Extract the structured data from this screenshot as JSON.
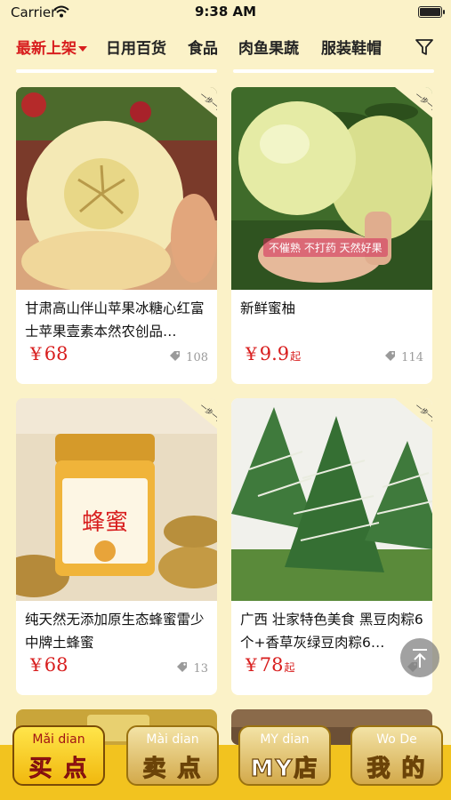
{
  "status_bar": {
    "carrier": "Carrier",
    "time": "9:38 AM"
  },
  "tabs": [
    {
      "label": "最新上架",
      "active": true
    },
    {
      "label": "日用百货",
      "active": false
    },
    {
      "label": "食品",
      "active": false
    },
    {
      "label": "肉鱼果蔬",
      "active": false
    },
    {
      "label": "服装鞋帽",
      "active": false
    }
  ],
  "badge": "一步一品",
  "products": [
    {
      "title": "甘肃高山伴山苹果冰糖心红富士苹果壹素本然农创品…",
      "price_symbol": "¥",
      "price": "68",
      "qi": "",
      "sold": "108",
      "caption": ""
    },
    {
      "title": "新鲜蜜柚",
      "price_symbol": "¥",
      "price": "9.9",
      "qi": "起",
      "sold": "114",
      "caption": "不催熟 不打药 天然好果"
    },
    {
      "title": "纯天然无添加原生态蜂蜜雷少中牌土蜂蜜",
      "price_symbol": "¥",
      "price": "68",
      "qi": "",
      "sold": "13",
      "caption": ""
    },
    {
      "title": "广西 壮家特色美食 黑豆肉粽6个+香草灰绿豆肉粽6…",
      "price_symbol": "¥",
      "price": "78",
      "qi": "起",
      "sold": "",
      "caption": ""
    }
  ],
  "jar_label": "蜂蜜",
  "bottom_nav": [
    {
      "pinyin": "Mǎi dian",
      "label": "买 点",
      "active": true
    },
    {
      "pinyin": "Mài dian",
      "label": "卖 点",
      "active": false
    },
    {
      "pinyin": "MY dian",
      "label": "MY店",
      "active": false
    },
    {
      "pinyin": "Wo De",
      "label": "我 的",
      "active": false
    }
  ],
  "colors": {
    "background": "#fbf2c8",
    "accent_red": "#d81e1e",
    "nav_yellow": "#f2c31f"
  },
  "icons": [
    "wifi-icon",
    "battery-icon",
    "filter-icon",
    "tag-icon",
    "scroll-to-top-icon"
  ]
}
